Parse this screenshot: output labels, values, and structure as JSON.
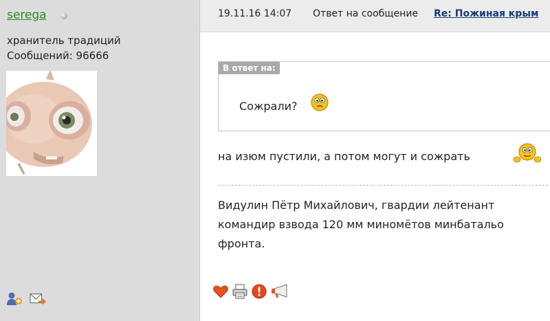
{
  "user": {
    "name": "serega",
    "title": "хранитель традиций",
    "post_count": "Сообщений: 96666",
    "name_color": "#2a8a2a",
    "status": "offline"
  },
  "header": {
    "date": "19.11.16 14:07",
    "reply_label": "Ответ на сообщение",
    "thread_link": "Re: Пожиная крым"
  },
  "quote": {
    "label": "В ответ на:",
    "text": "Сожрали?"
  },
  "reply_text": "на изюм пустили, а потом могут и сожрать",
  "signature": {
    "line1": "Видулин Пётр Михайлович, гвардии лейтенант",
    "line2": "командир взвода 120 мм миномётов минбатальо",
    "line3": "фронта."
  },
  "icons": {
    "sidebar": [
      "add-friend-icon",
      "send-message-icon"
    ],
    "actions": [
      "like-heart-icon",
      "print-icon",
      "report-icon",
      "megaphone-icon"
    ],
    "smileys": [
      "confused-smiley-icon",
      "peeking-smiley-icon"
    ]
  }
}
